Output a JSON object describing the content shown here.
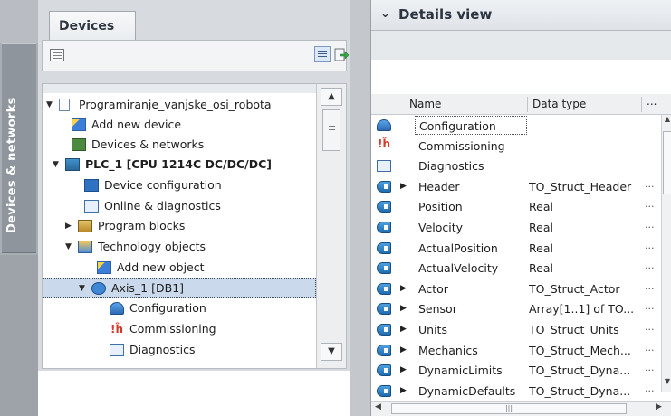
{
  "left_strip": {
    "label": "Devices & networks"
  },
  "devices_panel": {
    "tab_label": "Devices",
    "tree": [
      {
        "label": "Programiranje_vanjske_osi_robota",
        "icon": "project-icon",
        "expander": "▼"
      },
      {
        "label": "Add new device",
        "icon": "add-device-icon",
        "expander": ""
      },
      {
        "label": "Devices & networks",
        "icon": "network-icon",
        "expander": ""
      },
      {
        "label": "PLC_1 [CPU 1214C DC/DC/DC]",
        "icon": "plc-icon",
        "expander": "▼",
        "bold": true
      },
      {
        "label": "Device configuration",
        "icon": "device-configuration-icon",
        "expander": ""
      },
      {
        "label": "Online & diagnostics",
        "icon": "diagnostics-icon",
        "expander": ""
      },
      {
        "label": "Program blocks",
        "icon": "program-blocks-icon",
        "expander": "▶"
      },
      {
        "label": "Technology objects",
        "icon": "technology-objects-icon",
        "expander": "▼"
      },
      {
        "label": "Add new object",
        "icon": "add-object-icon",
        "expander": ""
      },
      {
        "label": "Axis_1 [DB1]",
        "icon": "axis-icon",
        "expander": "▼",
        "selected": true
      },
      {
        "label": "Configuration",
        "icon": "configuration-icon",
        "expander": ""
      },
      {
        "label": "Commissioning",
        "icon": "commissioning-icon",
        "expander": ""
      },
      {
        "label": "Diagnostics",
        "icon": "diagnostics-icon",
        "expander": ""
      }
    ]
  },
  "details_view": {
    "title": "Details view",
    "columns": {
      "name": "Name",
      "type": "Data type",
      "more": "..."
    },
    "rows": [
      {
        "name": "Configuration",
        "type": "",
        "icon": "configuration-icon",
        "expander": "",
        "dots": ""
      },
      {
        "name": "Commissioning",
        "type": "",
        "icon": "commissioning-icon",
        "expander": "",
        "dots": ""
      },
      {
        "name": "Diagnostics",
        "type": "",
        "icon": "diagnostics-icon",
        "expander": "",
        "dots": ""
      },
      {
        "name": "Header",
        "type": "TO_Struct_Header",
        "icon": "variable-icon",
        "expander": "▶",
        "dots": "..."
      },
      {
        "name": "Position",
        "type": "Real",
        "icon": "variable-icon",
        "expander": "",
        "dots": "..."
      },
      {
        "name": "Velocity",
        "type": "Real",
        "icon": "variable-icon",
        "expander": "",
        "dots": "..."
      },
      {
        "name": "ActualPosition",
        "type": "Real",
        "icon": "variable-icon",
        "expander": "",
        "dots": "..."
      },
      {
        "name": "ActualVelocity",
        "type": "Real",
        "icon": "variable-icon",
        "expander": "",
        "dots": "..."
      },
      {
        "name": "Actor",
        "type": "TO_Struct_Actor",
        "icon": "variable-icon",
        "expander": "▶",
        "dots": "..."
      },
      {
        "name": "Sensor",
        "type": "Array[1..1] of TO...",
        "icon": "variable-icon",
        "expander": "▶",
        "dots": "..."
      },
      {
        "name": "Units",
        "type": "TO_Struct_Units",
        "icon": "variable-icon",
        "expander": "▶",
        "dots": "..."
      },
      {
        "name": "Mechanics",
        "type": "TO_Struct_Mech...",
        "icon": "variable-icon",
        "expander": "▶",
        "dots": "..."
      },
      {
        "name": "DynamicLimits",
        "type": "TO_Struct_Dyna...",
        "icon": "variable-icon",
        "expander": "▶",
        "dots": "..."
      },
      {
        "name": "DynamicDefaults",
        "type": "TO_Struct_Dyna...",
        "icon": "variable-icon",
        "expander": "▶",
        "dots": "..."
      }
    ]
  }
}
